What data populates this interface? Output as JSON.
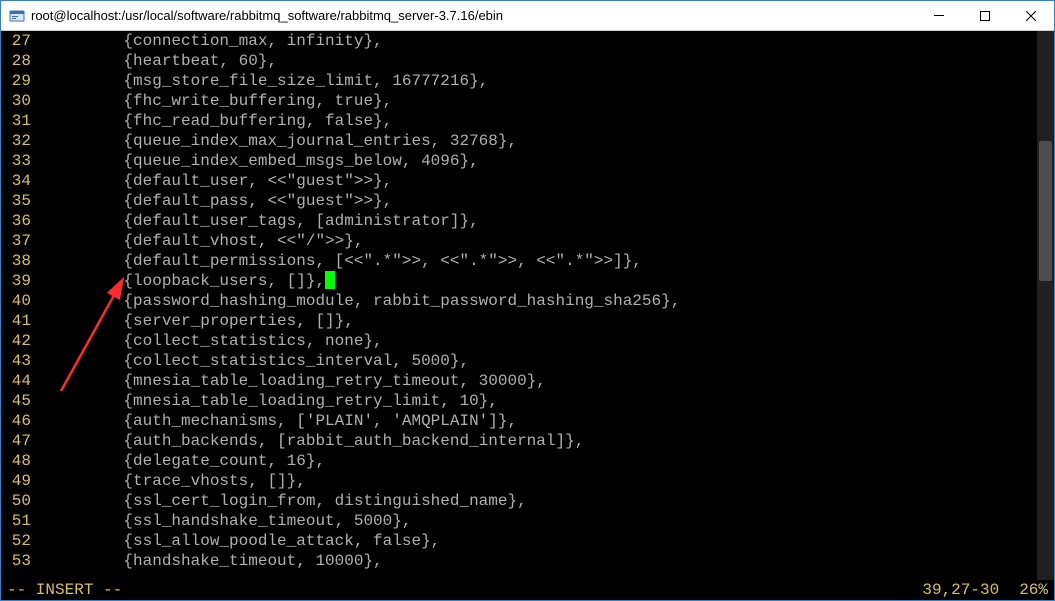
{
  "window": {
    "title": "root@localhost:/usr/local/software/rabbitmq_software/rabbitmq_server-3.7.16/ebin"
  },
  "lines": [
    {
      "n": "27",
      "t": "         {connection_max, infinity},"
    },
    {
      "n": "28",
      "t": "         {heartbeat, 60},"
    },
    {
      "n": "29",
      "t": "         {msg_store_file_size_limit, 16777216},"
    },
    {
      "n": "30",
      "t": "         {fhc_write_buffering, true},"
    },
    {
      "n": "31",
      "t": "         {fhc_read_buffering, false},"
    },
    {
      "n": "32",
      "t": "         {queue_index_max_journal_entries, 32768},"
    },
    {
      "n": "33",
      "t": "         {queue_index_embed_msgs_below, 4096},"
    },
    {
      "n": "34",
      "t": "         {default_user, <<\"guest\">>},"
    },
    {
      "n": "35",
      "t": "         {default_pass, <<\"guest\">>},"
    },
    {
      "n": "36",
      "t": "         {default_user_tags, [administrator]},"
    },
    {
      "n": "37",
      "t": "         {default_vhost, <<\"/\">>},"
    },
    {
      "n": "38",
      "t": "         {default_permissions, [<<\".*\">>, <<\".*\">>, <<\".*\">>]},"
    },
    {
      "n": "39",
      "t": "         {loopback_users, []},",
      "cursor": true
    },
    {
      "n": "40",
      "t": "         {password_hashing_module, rabbit_password_hashing_sha256},"
    },
    {
      "n": "41",
      "t": "         {server_properties, []},"
    },
    {
      "n": "42",
      "t": "         {collect_statistics, none},"
    },
    {
      "n": "43",
      "t": "         {collect_statistics_interval, 5000},"
    },
    {
      "n": "44",
      "t": "         {mnesia_table_loading_retry_timeout, 30000},"
    },
    {
      "n": "45",
      "t": "         {mnesia_table_loading_retry_limit, 10},"
    },
    {
      "n": "46",
      "t": "         {auth_mechanisms, ['PLAIN', 'AMQPLAIN']},"
    },
    {
      "n": "47",
      "t": "         {auth_backends, [rabbit_auth_backend_internal]},"
    },
    {
      "n": "48",
      "t": "         {delegate_count, 16},"
    },
    {
      "n": "49",
      "t": "         {trace_vhosts, []},"
    },
    {
      "n": "50",
      "t": "         {ssl_cert_login_from, distinguished_name},"
    },
    {
      "n": "51",
      "t": "         {ssl_handshake_timeout, 5000},"
    },
    {
      "n": "52",
      "t": "         {ssl_allow_poodle_attack, false},"
    },
    {
      "n": "53",
      "t": "         {handshake_timeout, 10000},"
    }
  ],
  "status": {
    "mode": "-- INSERT --",
    "position": "39,27-30",
    "percent": "26%"
  }
}
